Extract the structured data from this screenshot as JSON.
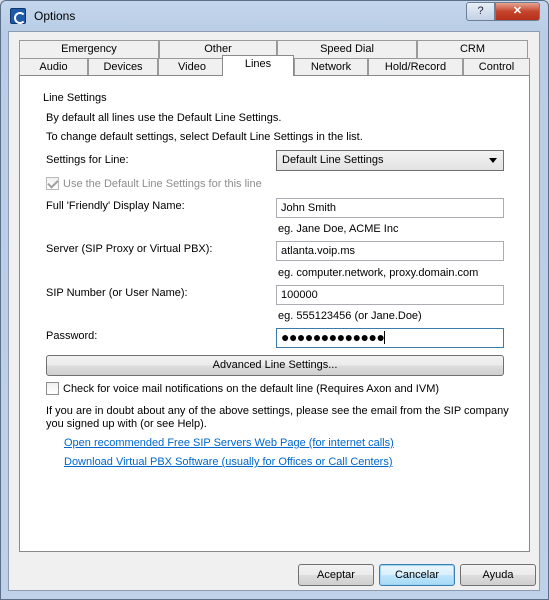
{
  "window": {
    "title": "Options",
    "help_glyph": "?",
    "close_glyph": "✕"
  },
  "tabs_row1": [
    "Emergency",
    "Other",
    "Speed Dial",
    "CRM"
  ],
  "tabs_row2": [
    "Audio",
    "Devices",
    "Video",
    "Lines",
    "Network",
    "Hold/Record",
    "Control"
  ],
  "active_tab": "Lines",
  "line_settings": {
    "group_title": "Line Settings",
    "intro1": "By default all lines use the Default Line Settings.",
    "intro2": "To change default settings, select Default Line Settings in the list.",
    "settings_for_line_label": "Settings for Line:",
    "settings_for_line_value": "Default Line Settings",
    "use_default_label": "Use the Default Line Settings for this line",
    "display_name_label": "Full 'Friendly' Display Name:",
    "display_name_value": "John Smith",
    "display_name_hint": "eg. Jane Doe, ACME Inc",
    "server_label": "Server (SIP Proxy or Virtual PBX):",
    "server_value": "atlanta.voip.ms",
    "server_hint": "eg. computer.network, proxy.domain.com",
    "sip_number_label": "SIP Number (or User Name):",
    "sip_number_value": "100000",
    "sip_number_hint": "eg. 555123456 (or Jane.Doe)",
    "password_label": "Password:",
    "password_value": "●●●●●●●●●●●●●",
    "advanced_button": "Advanced Line Settings...",
    "voicemail_label": "Check for voice mail notifications on the default line (Requires Axon and IVM)",
    "doubt_line1": "If you are in doubt about any of the above settings, please see the email from the SIP company",
    "doubt_line2": "you signed up with (or see Help).",
    "link1": "Open recommended Free SIP Servers Web Page (for internet calls)",
    "link2": "Download Virtual PBX Software (usually for Offices or Call Centers)"
  },
  "buttons": {
    "accept": "Aceptar",
    "cancel": "Cancelar",
    "help": "Ayuda"
  }
}
